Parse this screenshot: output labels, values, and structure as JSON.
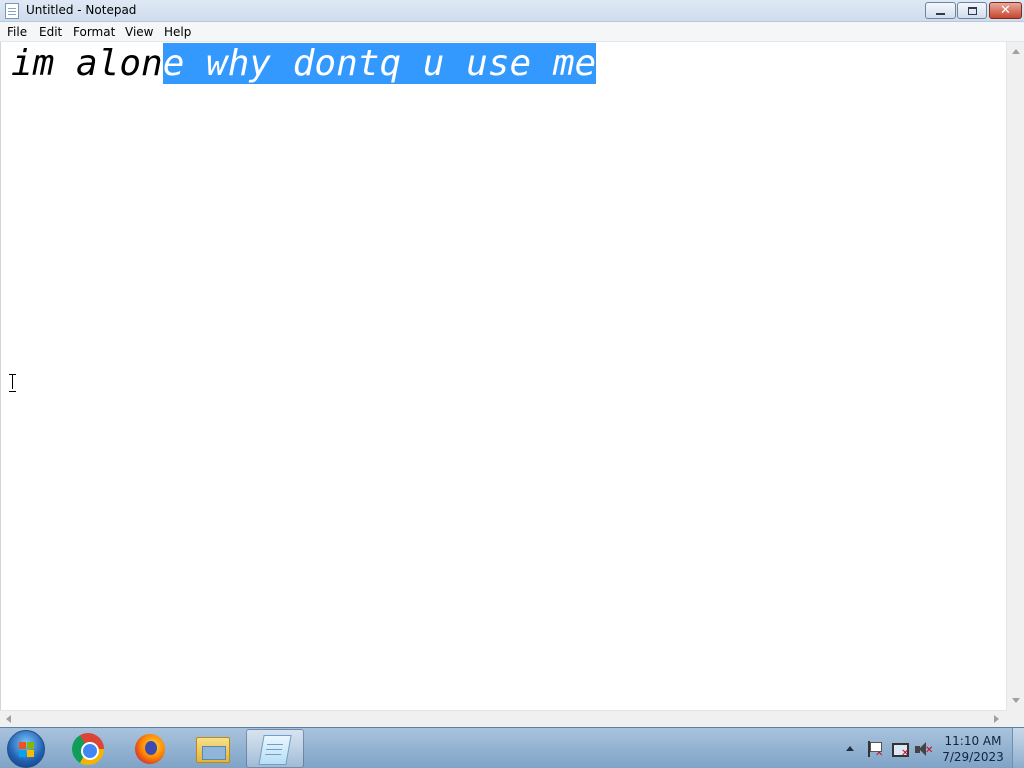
{
  "window": {
    "title": "Untitled - Notepad",
    "buttons": {
      "minimize_icon": "minimize-icon",
      "restore_icon": "restore-icon",
      "close_icon": "close-icon"
    }
  },
  "menu": {
    "items": [
      {
        "label": "File"
      },
      {
        "label": "Edit"
      },
      {
        "label": "Format"
      },
      {
        "label": "View"
      },
      {
        "label": "Help"
      }
    ]
  },
  "editor": {
    "text_before_selection": "im alon",
    "selected_text": "e why dontq u use me",
    "selection_color": "#3399ff"
  },
  "taskbar": {
    "pinned": [
      {
        "name": "Google Chrome",
        "icon": "chrome-icon"
      },
      {
        "name": "Firefox",
        "icon": "firefox-icon"
      },
      {
        "name": "Windows Explorer",
        "icon": "folder-icon"
      },
      {
        "name": "Notepad",
        "icon": "notepad-icon",
        "active": true
      }
    ],
    "clock": {
      "time": "11:10 AM",
      "date": "7/29/2023"
    }
  }
}
